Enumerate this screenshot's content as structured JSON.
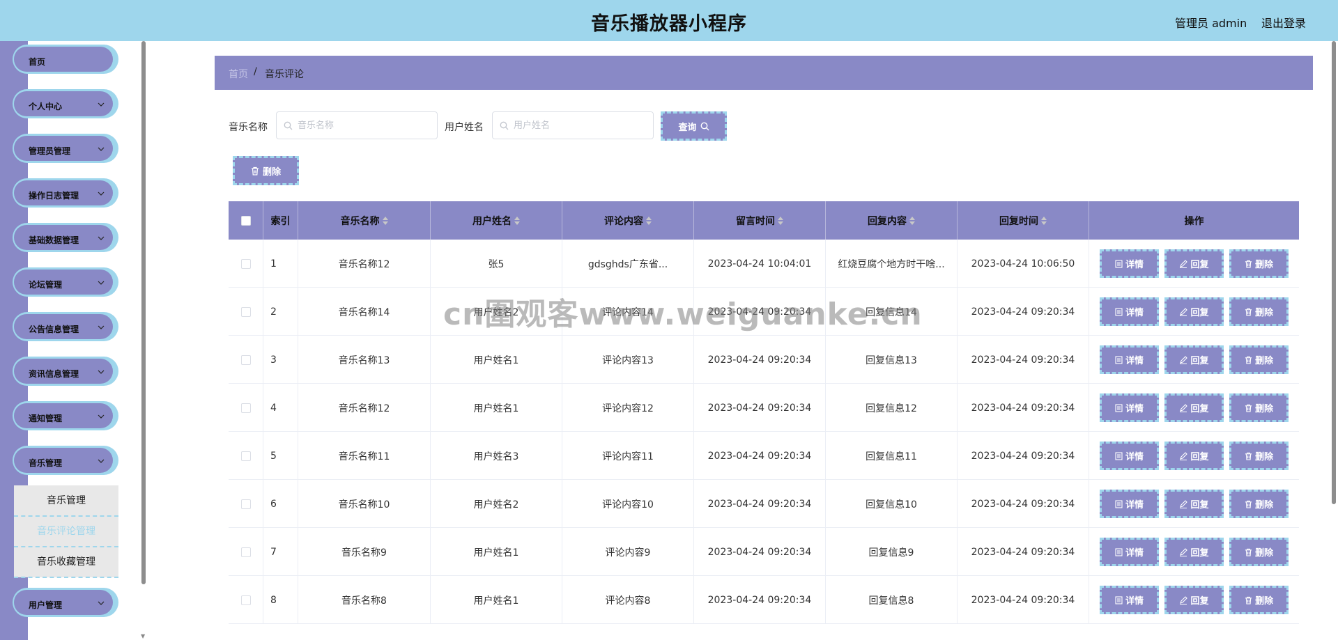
{
  "header": {
    "title": "音乐播放器小程序",
    "admin": "管理员 admin",
    "logout": "退出登录"
  },
  "sidebar": {
    "items": [
      {
        "label": "首页",
        "chevron": false
      },
      {
        "label": "个人中心",
        "chevron": true
      },
      {
        "label": "管理员管理",
        "chevron": true
      },
      {
        "label": "操作日志管理",
        "chevron": true
      },
      {
        "label": "基础数据管理",
        "chevron": true
      },
      {
        "label": "论坛管理",
        "chevron": true
      },
      {
        "label": "公告信息管理",
        "chevron": true
      },
      {
        "label": "资讯信息管理",
        "chevron": true
      },
      {
        "label": "通知管理",
        "chevron": true
      },
      {
        "label": "音乐管理",
        "chevron": true
      },
      {
        "label": "用户管理",
        "chevron": true
      }
    ],
    "submenu": [
      {
        "label": "音乐管理",
        "active": false
      },
      {
        "label": "音乐评论管理",
        "active": true
      },
      {
        "label": "音乐收藏管理",
        "active": false
      }
    ]
  },
  "breadcrumb": {
    "home": "首页",
    "separator": "/",
    "current": "音乐评论"
  },
  "search": {
    "music_label": "音乐名称",
    "music_placeholder": "音乐名称",
    "user_label": "用户姓名",
    "user_placeholder": "用户姓名",
    "query_button": "查询",
    "delete_button": "删除"
  },
  "table": {
    "columns": [
      "索引",
      "音乐名称",
      "用户姓名",
      "评论内容",
      "留言时间",
      "回复内容",
      "回复时间",
      "操作"
    ],
    "actions": {
      "detail": "详情",
      "reply": "回复",
      "delete": "删除"
    },
    "rows": [
      {
        "index": "1",
        "music": "音乐名称12",
        "user": "张5",
        "comment": "gdsghds广东省...",
        "time": "2023-04-24 10:04:01",
        "reply": "红烧豆腐个地方时干啥...",
        "reply_time": "2023-04-24 10:06:50"
      },
      {
        "index": "2",
        "music": "音乐名称14",
        "user": "用户姓名2",
        "comment": "评论内容14",
        "time": "2023-04-24 09:20:34",
        "reply": "回复信息14",
        "reply_time": "2023-04-24 09:20:34"
      },
      {
        "index": "3",
        "music": "音乐名称13",
        "user": "用户姓名1",
        "comment": "评论内容13",
        "time": "2023-04-24 09:20:34",
        "reply": "回复信息13",
        "reply_time": "2023-04-24 09:20:34"
      },
      {
        "index": "4",
        "music": "音乐名称12",
        "user": "用户姓名1",
        "comment": "评论内容12",
        "time": "2023-04-24 09:20:34",
        "reply": "回复信息12",
        "reply_time": "2023-04-24 09:20:34"
      },
      {
        "index": "5",
        "music": "音乐名称11",
        "user": "用户姓名3",
        "comment": "评论内容11",
        "time": "2023-04-24 09:20:34",
        "reply": "回复信息11",
        "reply_time": "2023-04-24 09:20:34"
      },
      {
        "index": "6",
        "music": "音乐名称10",
        "user": "用户姓名2",
        "comment": "评论内容10",
        "time": "2023-04-24 09:20:34",
        "reply": "回复信息10",
        "reply_time": "2023-04-24 09:20:34"
      },
      {
        "index": "7",
        "music": "音乐名称9",
        "user": "用户姓名1",
        "comment": "评论内容9",
        "time": "2023-04-24 09:20:34",
        "reply": "回复信息9",
        "reply_time": "2023-04-24 09:20:34"
      },
      {
        "index": "8",
        "music": "音乐名称8",
        "user": "用户姓名1",
        "comment": "评论内容8",
        "time": "2023-04-24 09:20:34",
        "reply": "回复信息8",
        "reply_time": "2023-04-24 09:20:34"
      }
    ]
  },
  "watermark": "cn圍观客www.weiguanke.cn",
  "colors": {
    "header_bg": "#9ed6ec",
    "accent": "#8989c6",
    "dash_border": "#9ed6ec"
  }
}
